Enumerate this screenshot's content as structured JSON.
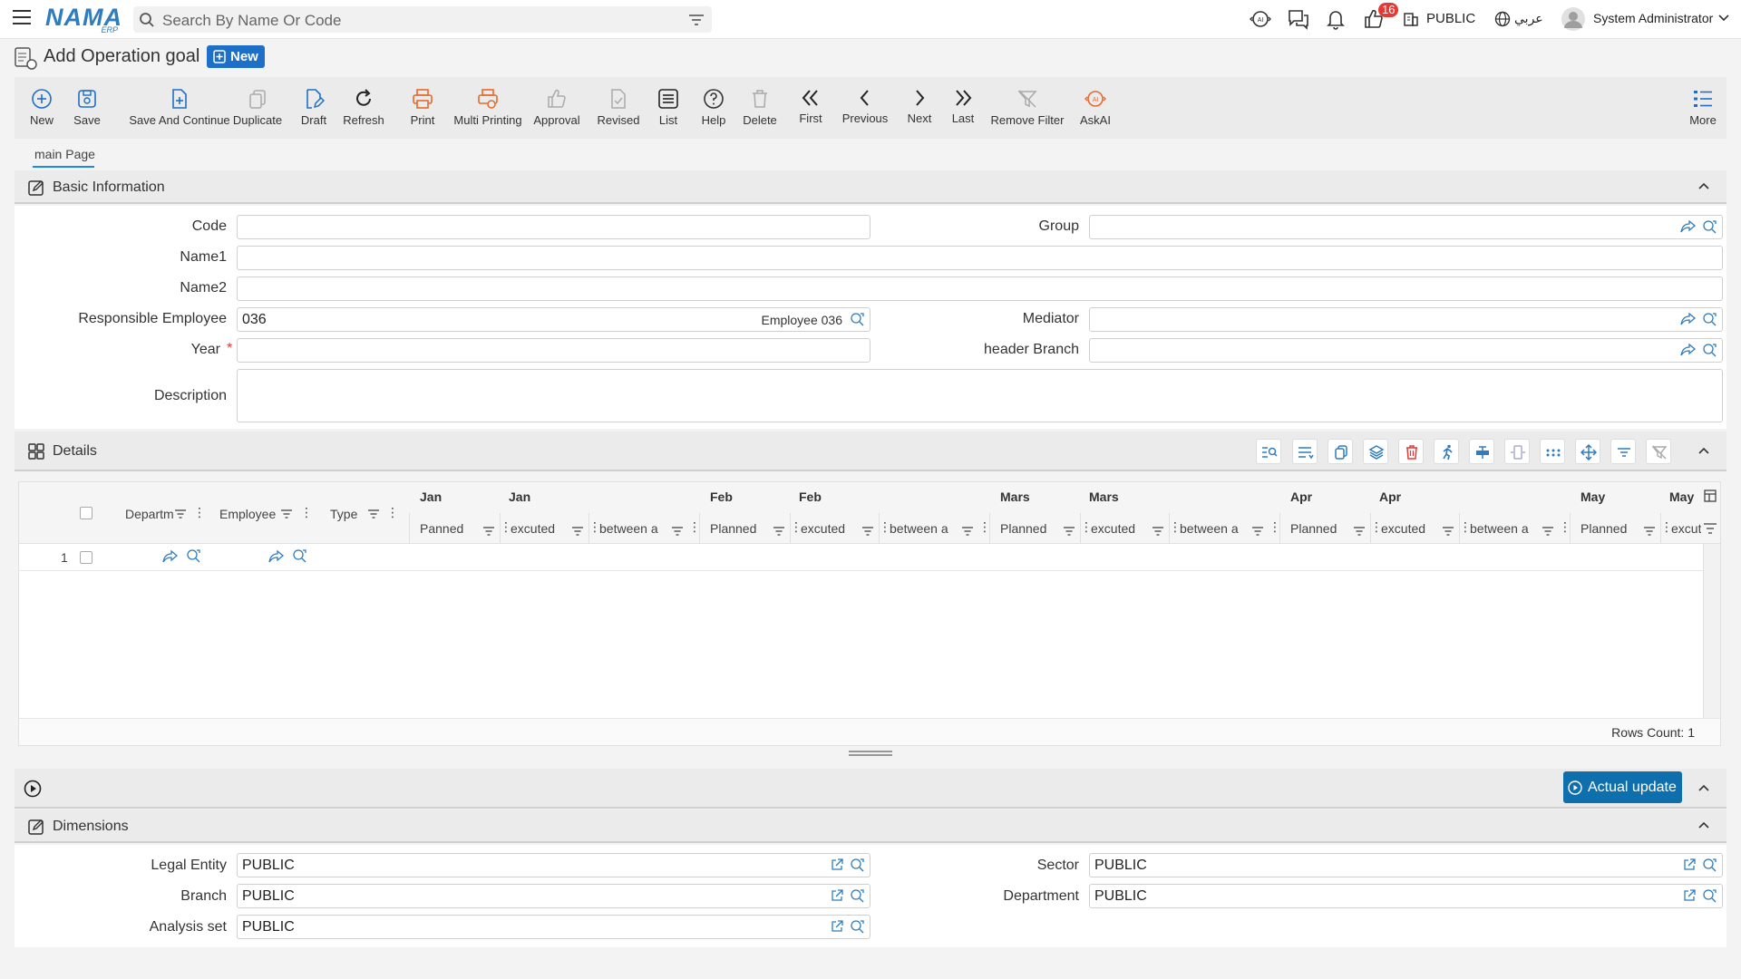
{
  "topbar": {
    "logo_main": "NAMA",
    "logo_sub": "ERP",
    "search_placeholder": "Search By Name Or Code",
    "notifications_count": "16",
    "company": "PUBLIC",
    "language": "عربي",
    "user": "System Administrator",
    "icons": [
      "menu-icon",
      "search-icon",
      "filter-icon",
      "ai-icon",
      "chat-icon",
      "bell-icon",
      "thumbs-up-icon",
      "building-icon",
      "globe-icon",
      "avatar-icon"
    ]
  },
  "page": {
    "title": "Add Operation goal",
    "status_badge": "New"
  },
  "toolbar": {
    "new": "New",
    "save": "Save",
    "save_continue": "Save And Continue",
    "duplicate": "Duplicate",
    "draft": "Draft",
    "refresh": "Refresh",
    "print": "Print",
    "multi_printing": "Multi Printing",
    "approval": "Approval",
    "revised": "Revised",
    "list": "List",
    "help": "Help",
    "delete": "Delete",
    "first": "First",
    "previous": "Previous",
    "next": "Next",
    "last": "Last",
    "remove_filter": "Remove Filter",
    "askai": "AskAI",
    "more": "More"
  },
  "tabs": {
    "main": "main Page"
  },
  "basic": {
    "title": "Basic Information",
    "code_label": "Code",
    "code_value": "",
    "group_label": "Group",
    "group_value": "",
    "name1_label": "Name1",
    "name1_value": "",
    "name2_label": "Name2",
    "name2_value": "",
    "resp_label": "Responsible Employee",
    "resp_value": "036",
    "resp_name": "Employee 036",
    "mediator_label": "Mediator",
    "mediator_value": "",
    "year_label": "Year",
    "year_required": "*",
    "year_value": "",
    "branch_label": "header Branch",
    "branch_value": "",
    "desc_label": "Description",
    "desc_value": ""
  },
  "details": {
    "title": "Details",
    "columns": {
      "department": "Departm",
      "employee": "Employee",
      "type": "Type"
    },
    "months": [
      {
        "m1": "Jan",
        "m2": "Jan",
        "c1": "Panned",
        "c2": "excuted",
        "c3": "between a"
      },
      {
        "m1": "Feb",
        "m2": "Feb",
        "c1": "Planned",
        "c2": "excuted",
        "c3": "between a"
      },
      {
        "m1": "Mars",
        "m2": "Mars",
        "c1": "Planned",
        "c2": "excuted",
        "c3": "between a"
      },
      {
        "m1": "Apr",
        "m2": "Apr",
        "c1": "Planned",
        "c2": "excuted",
        "c3": "between a"
      },
      {
        "m1": "May",
        "m2": "May",
        "c1": "Planned",
        "c2": "excut",
        "c3": ""
      }
    ],
    "row_number": "1",
    "rows_count": "Rows Count: 1"
  },
  "actions": {
    "actual_update": "Actual update"
  },
  "dimensions": {
    "title": "Dimensions",
    "legal_label": "Legal Entity",
    "legal_value": "PUBLIC",
    "sector_label": "Sector",
    "sector_value": "PUBLIC",
    "branch_label": "Branch",
    "branch_value": "PUBLIC",
    "dept_label": "Department",
    "dept_value": "PUBLIC",
    "analysis_label": "Analysis set",
    "analysis_value": "PUBLIC"
  }
}
